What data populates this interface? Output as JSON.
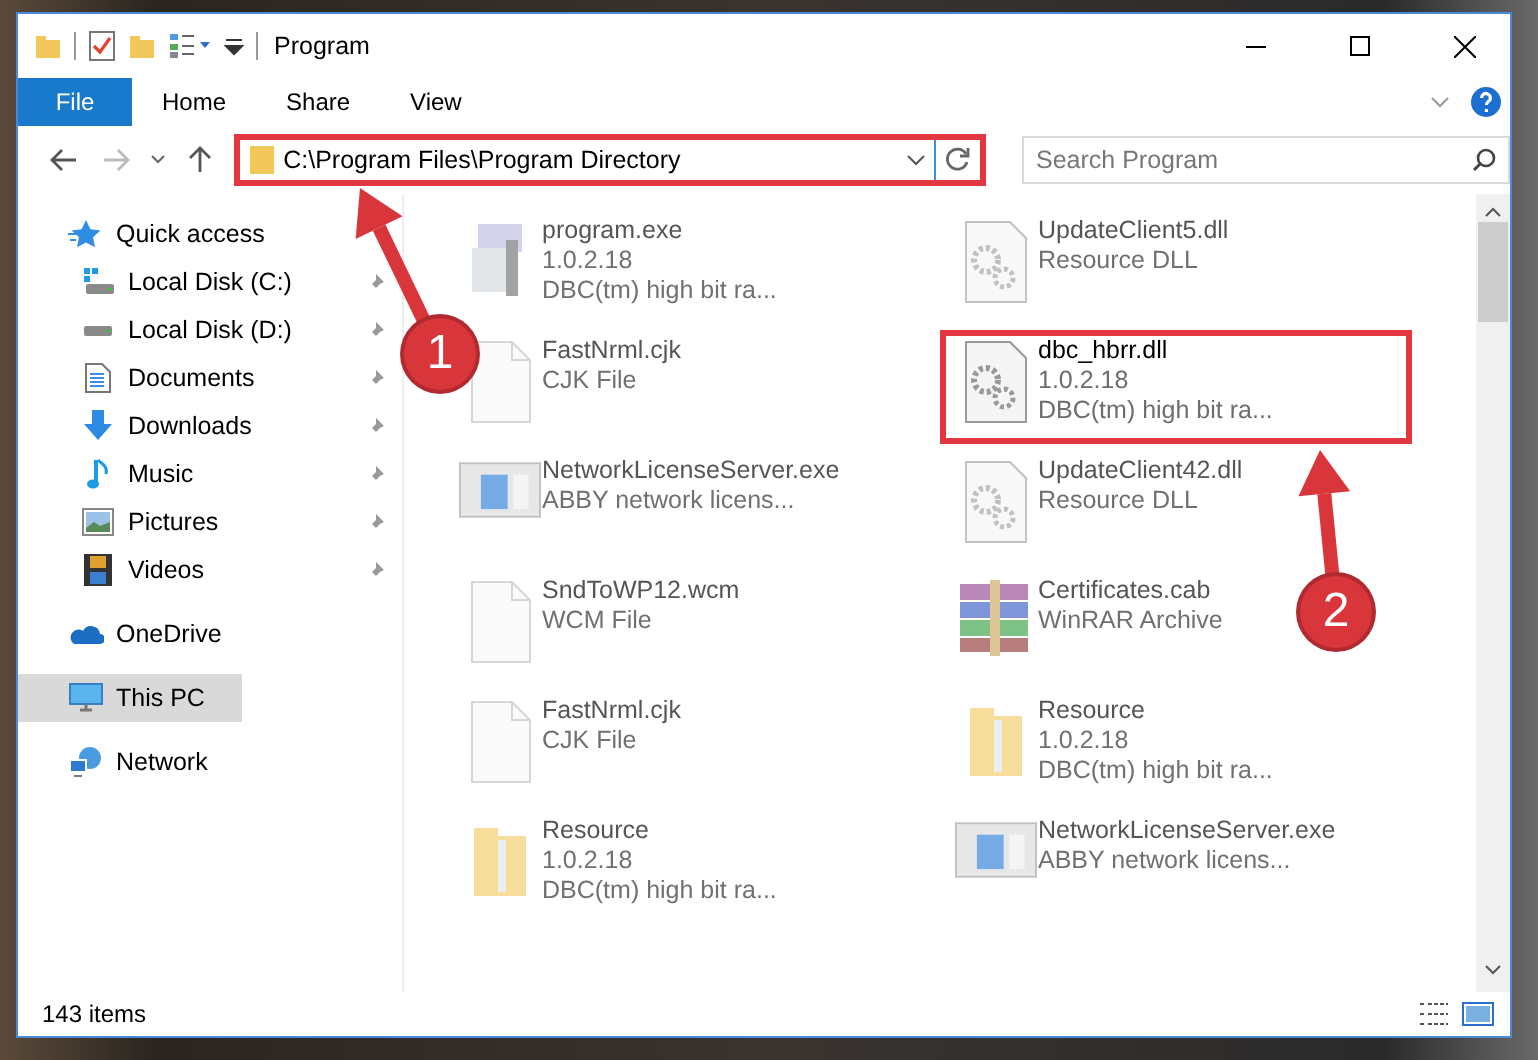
{
  "window": {
    "title": "Program"
  },
  "ribbon_tabs": [
    {
      "label": "File",
      "kind": "menu"
    },
    {
      "label": "Home",
      "kind": "tab"
    },
    {
      "label": "Share",
      "kind": "tab"
    },
    {
      "label": "View",
      "kind": "tab"
    }
  ],
  "address_bar": {
    "path": "C:\\Program Files\\Program Directory",
    "highlighted": true
  },
  "search": {
    "placeholder": "Search Program"
  },
  "sidebar": {
    "items": [
      {
        "label": "Quick access",
        "kind": "star",
        "selected": false,
        "children": [
          {
            "label": "Local Disk (C:)",
            "kind": "windrive",
            "pinned": true
          },
          {
            "label": "Local Disk (D:)",
            "kind": "drive",
            "pinned": true
          },
          {
            "label": "Documents",
            "kind": "document",
            "pinned": true
          },
          {
            "label": "Downloads",
            "kind": "download",
            "pinned": true
          },
          {
            "label": "Music",
            "kind": "music",
            "pinned": true
          },
          {
            "label": "Pictures",
            "kind": "picture",
            "pinned": true
          },
          {
            "label": "Videos",
            "kind": "video",
            "pinned": true
          }
        ]
      },
      {
        "label": "OneDrive",
        "kind": "cloud",
        "selected": false
      },
      {
        "label": "This PC",
        "kind": "computer",
        "selected": true
      },
      {
        "label": "Network",
        "kind": "network",
        "selected": false
      }
    ]
  },
  "files": [
    {
      "name": "program.exe",
      "details": [
        "1.0.2.18",
        "DBC(tm) high bit ra..."
      ],
      "kind": "app",
      "blurred": true,
      "highlighted": false
    },
    {
      "name": "UpdateClient5.dll",
      "details": [
        "Resource DLL"
      ],
      "kind": "dll",
      "blurred": true,
      "highlighted": false
    },
    {
      "name": "FastNrml.cjk",
      "details": [
        "CJK File"
      ],
      "kind": "blank",
      "blurred": true,
      "highlighted": false
    },
    {
      "name": "dbc_hbrr.dll",
      "details": [
        "1.0.2.18",
        "DBC(tm) high bit ra..."
      ],
      "kind": "dll",
      "blurred": false,
      "highlighted": true
    },
    {
      "name": "NetworkLicenseServer.exe",
      "details": [
        "ABBY network licens..."
      ],
      "kind": "window",
      "blurred": true,
      "highlighted": false
    },
    {
      "name": "UpdateClient42.dll",
      "details": [
        "Resource DLL"
      ],
      "kind": "dll",
      "blurred": true,
      "highlighted": false
    },
    {
      "name": "SndToWP12.wcm",
      "details": [
        "WCM File"
      ],
      "kind": "blank",
      "blurred": true,
      "highlighted": false
    },
    {
      "name": "Certificates.cab",
      "details": [
        "WinRAR Archive"
      ],
      "kind": "archive",
      "blurred": true,
      "highlighted": false
    },
    {
      "name": "FastNrml.cjk",
      "details": [
        "CJK File"
      ],
      "kind": "blank",
      "blurred": true,
      "highlighted": false
    },
    {
      "name": "Resource",
      "details": [
        "1.0.2.18",
        "DBC(tm) high bit ra..."
      ],
      "kind": "folder",
      "blurred": true,
      "highlighted": false
    },
    {
      "name": "Resource",
      "details": [
        "1.0.2.18",
        "DBC(tm) high bit ra..."
      ],
      "kind": "folder",
      "blurred": true,
      "highlighted": false
    },
    {
      "name": "NetworkLicenseServer.exe",
      "details": [
        "ABBY network licens..."
      ],
      "kind": "window",
      "blurred": true,
      "highlighted": false
    }
  ],
  "status_bar": {
    "item_count": "143 items"
  },
  "callouts": [
    {
      "number": "1"
    },
    {
      "number": "2"
    }
  ]
}
